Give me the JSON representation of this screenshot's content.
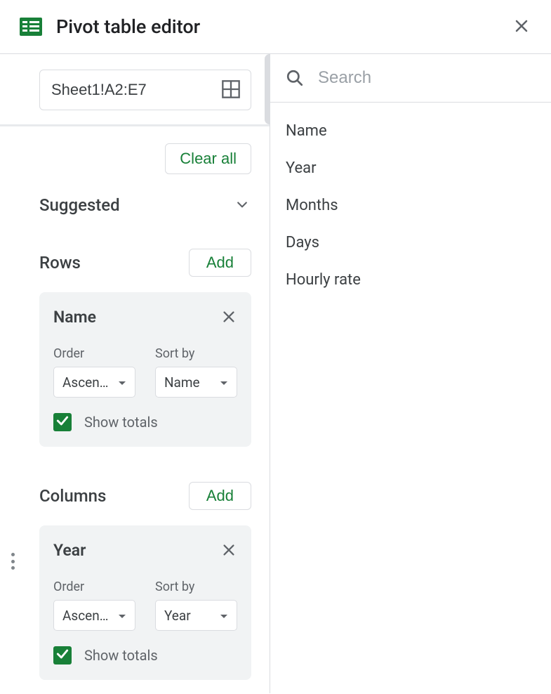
{
  "header": {
    "title": "Pivot table editor"
  },
  "range": {
    "value": "Sheet1!A2:E7"
  },
  "actions": {
    "clear_all": "Clear all"
  },
  "suggested": {
    "label": "Suggested"
  },
  "sections": {
    "rows": {
      "title": "Rows",
      "add_label": "Add",
      "card": {
        "title": "Name",
        "order_label": "Order",
        "order_value": "Ascen…",
        "sortby_label": "Sort by",
        "sortby_value": "Name",
        "show_totals_label": "Show totals",
        "show_totals_checked": true
      }
    },
    "columns": {
      "title": "Columns",
      "add_label": "Add",
      "card": {
        "title": "Year",
        "order_label": "Order",
        "order_value": "Ascen…",
        "sortby_label": "Sort by",
        "sortby_value": "Year",
        "show_totals_label": "Show totals",
        "show_totals_checked": true
      }
    }
  },
  "search": {
    "placeholder": "Search"
  },
  "fields": [
    "Name",
    "Year",
    "Months",
    "Days",
    "Hourly rate"
  ],
  "colors": {
    "accent": "#188038",
    "border": "#dadce0",
    "muted": "#5f6368",
    "text": "#3c4043"
  }
}
